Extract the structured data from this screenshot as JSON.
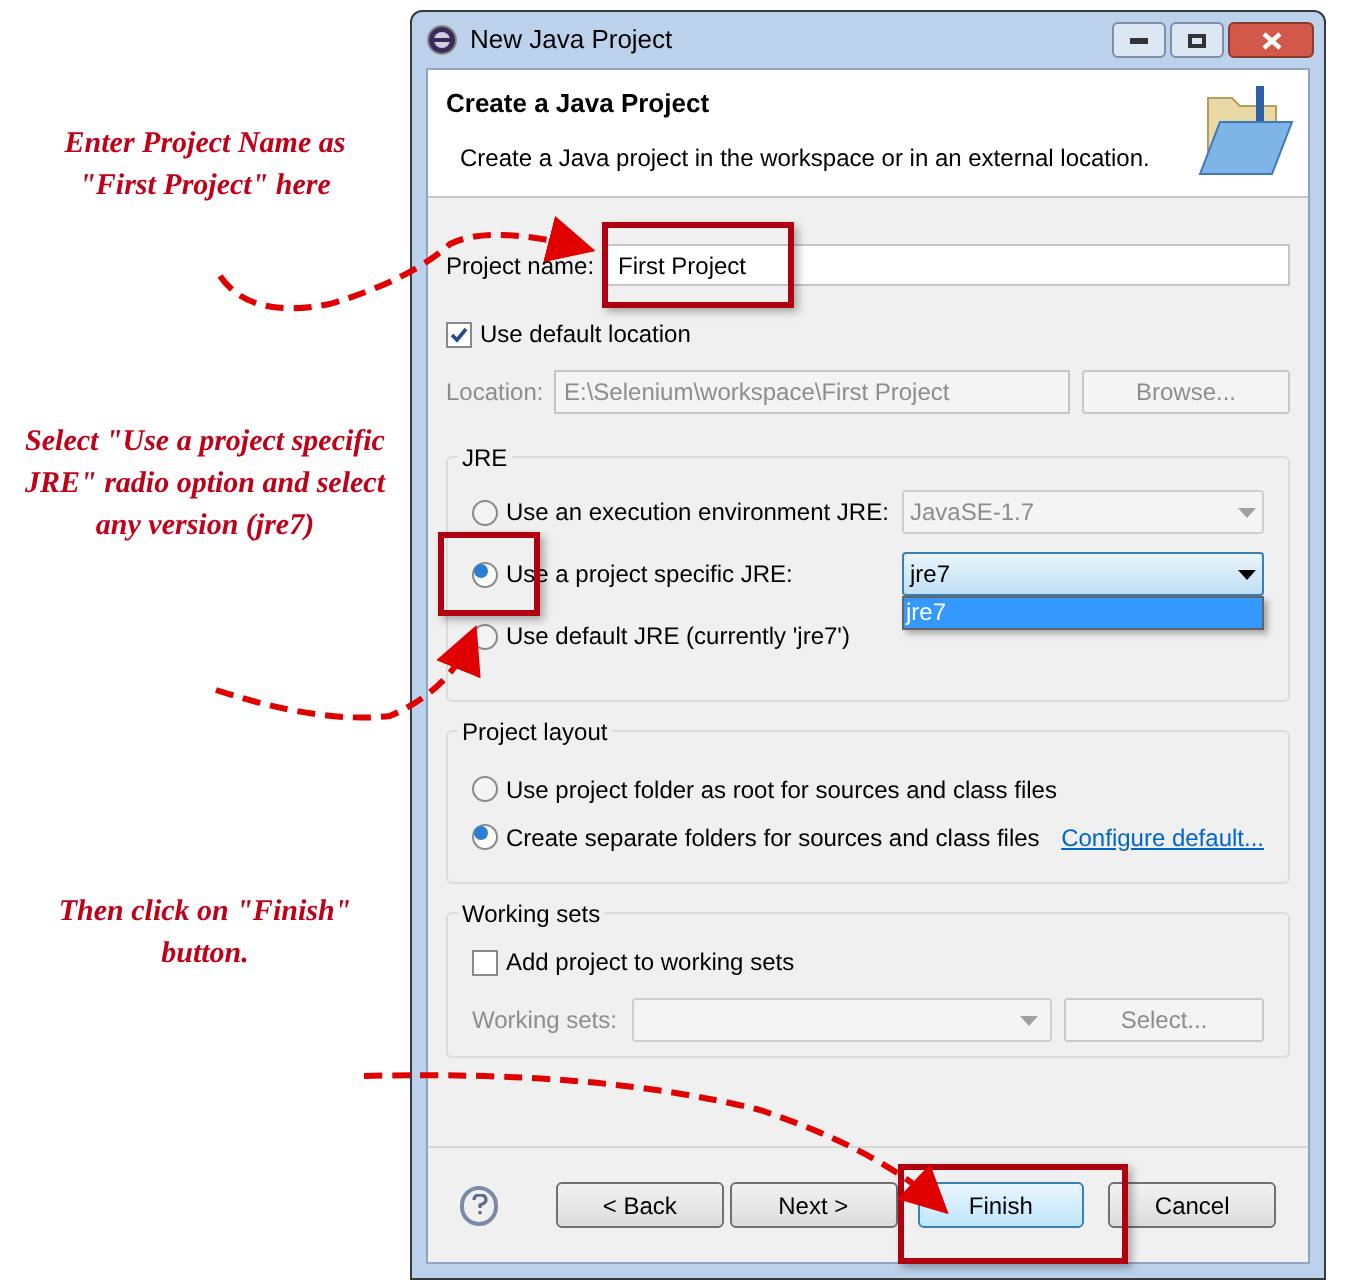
{
  "annotations": [
    {
      "text": "Enter Project Name as \"First Project\" here"
    },
    {
      "text": "Select \"Use a project specific JRE\" radio option and select any version (jre7)"
    },
    {
      "text": "Then click on \"Finish\" button."
    }
  ],
  "window": {
    "title": "New Java Project"
  },
  "header": {
    "title": "Create a Java Project",
    "description": "Create a Java project in the workspace or in an external location."
  },
  "project_name": {
    "label": "Project name:",
    "value": "First Project"
  },
  "use_default_location": {
    "label": "Use default location",
    "checked": true
  },
  "location": {
    "label": "Location:",
    "value": "E:\\Selenium\\workspace\\First Project",
    "disabled": true
  },
  "browse_button": {
    "label": "Browse...",
    "disabled": true
  },
  "jre": {
    "title": "JRE",
    "options": [
      {
        "label": "Use an execution environment JRE:",
        "selected": false,
        "select": {
          "value": "JavaSE-1.7",
          "disabled": true
        }
      },
      {
        "label": "Use a project specific JRE:",
        "selected": true,
        "select": {
          "value": "jre7",
          "disabled": false,
          "open": true,
          "items": [
            {
              "label": "jre7",
              "selected": true
            }
          ]
        }
      },
      {
        "label": "Use default JRE (currently 'jre7')",
        "selected": false
      }
    ]
  },
  "project_layout": {
    "title": "Project layout",
    "options": [
      {
        "label": "Use project folder as root for sources and class files",
        "selected": false
      },
      {
        "label": "Create separate folders for sources and class files",
        "selected": true
      }
    ],
    "link": "Configure default..."
  },
  "working_sets": {
    "title": "Working sets",
    "checkbox": {
      "label": "Add project to working sets",
      "checked": false
    },
    "field_label": "Working sets:",
    "select_disabled": true,
    "select_button": {
      "label": "Select...",
      "disabled": true
    }
  },
  "buttons": [
    {
      "label": "< Back",
      "default": false
    },
    {
      "label": "Next >",
      "default": false
    },
    {
      "label": "Finish",
      "default": true
    },
    {
      "label": "Cancel",
      "default": false
    }
  ]
}
